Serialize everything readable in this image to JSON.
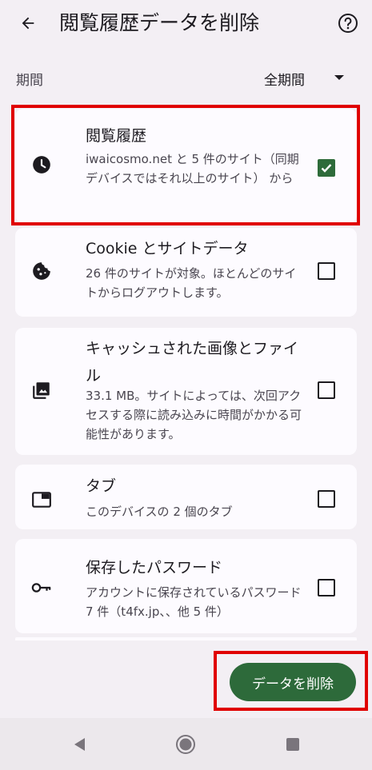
{
  "header": {
    "title": "閲覧履歴データを削除"
  },
  "period": {
    "label": "期間",
    "value": "全期間"
  },
  "items": [
    {
      "title": "閲覧履歴",
      "description": "iwaicosmo.net と 5 件のサイト（同期デバイスではそれ以上のサイト） から",
      "checked": true,
      "icon": "clock-icon"
    },
    {
      "title": "Cookie とサイトデータ",
      "description": "26 件のサイトが対象。ほとんどのサイトからログアウトします。",
      "checked": false,
      "icon": "cookie-icon"
    },
    {
      "title": "キャッシュされた画像とファイル",
      "description": "33.1 MB。サイトによっては、次回アクセスする際に読み込みに時間がかかる可能性があります。",
      "checked": false,
      "icon": "image-stack-icon"
    },
    {
      "title": "タブ",
      "description": "このデバイスの 2 個のタブ",
      "checked": false,
      "icon": "tab-icon"
    },
    {
      "title": "保存したパスワード",
      "description": "アカウントに保存されているパスワード 7 件（t4fx.jp、、他 5 件）",
      "checked": false,
      "icon": "key-icon"
    }
  ],
  "actions": {
    "delete_label": "データを削除"
  },
  "colors": {
    "accent": "#2d6a3a",
    "highlight": "#e00000",
    "background": "#f3eff4",
    "card": "#fdfbff"
  }
}
